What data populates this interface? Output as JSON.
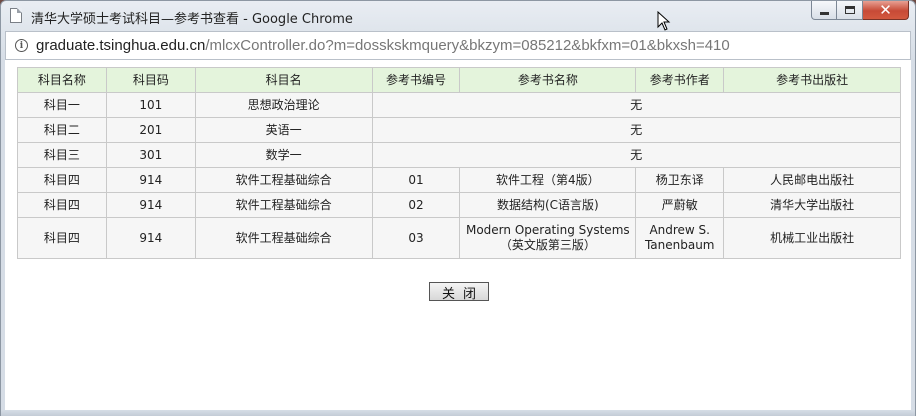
{
  "window": {
    "title": "清华大学硕士考试科目—参考书查看 - Google Chrome",
    "close_glyph": "✕"
  },
  "address": {
    "host": "graduate.tsinghua.edu.cn",
    "path": "/mlcxController.do?m=dosskskmquery&bkzym=085212&bkfxm=01&bkxsh=410",
    "info_glyph": "i"
  },
  "table": {
    "headers": [
      "科目名称",
      "科目码",
      "科目名",
      "参考书编号",
      "参考书名称",
      "参考书作者",
      "参考书出版社"
    ],
    "simple_rows": [
      {
        "name": "科目一",
        "code": "101",
        "subject": "思想政治理论",
        "none": "无"
      },
      {
        "name": "科目二",
        "code": "201",
        "subject": "英语一",
        "none": "无"
      },
      {
        "name": "科目三",
        "code": "301",
        "subject": "数学一",
        "none": "无"
      }
    ],
    "book_rows": [
      {
        "name": "科目四",
        "code": "914",
        "subject": "软件工程基础综合",
        "book_no": "01",
        "book_title": "软件工程（第4版）",
        "author": "杨卫东译",
        "publisher": "人民邮电出版社"
      },
      {
        "name": "科目四",
        "code": "914",
        "subject": "软件工程基础综合",
        "book_no": "02",
        "book_title": "数据结构(C语言版)",
        "author": "严蔚敏",
        "publisher": "清华大学出版社"
      },
      {
        "name": "科目四",
        "code": "914",
        "subject": "软件工程基础综合",
        "book_no": "03",
        "book_title": "Modern Operating Systems（英文版第三版）",
        "author": "Andrew S. Tanenbaum",
        "publisher": "机械工业出版社"
      }
    ]
  },
  "close_button_label": "关闭",
  "colors": {
    "header_bg": "#e4f4dc",
    "cell_bg": "#f6f6f6",
    "border": "#c9c9c9"
  }
}
